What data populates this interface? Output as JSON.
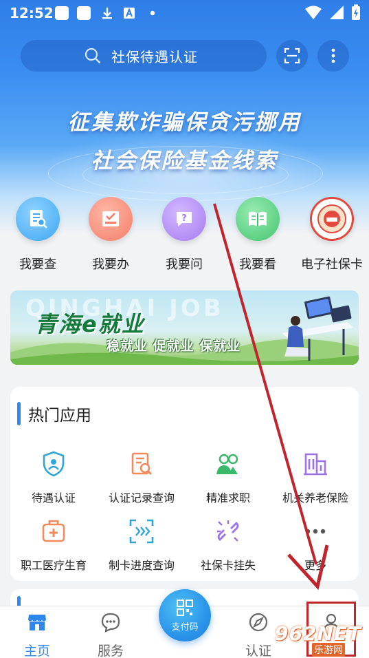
{
  "status_bar": {
    "time": "12:52"
  },
  "search": {
    "placeholder": "社保待遇认证"
  },
  "banner": {
    "line1": "征集欺诈骗保贪污挪用",
    "line2": "社会保险基金线索",
    "sub": ""
  },
  "quick_actions": [
    {
      "label": "我要查",
      "icon": "document-search-icon",
      "color": "#3fa6f2"
    },
    {
      "label": "我要办",
      "icon": "checklist-icon",
      "color": "#f57d6a"
    },
    {
      "label": "我要问",
      "icon": "chat-question-icon",
      "color": "#a57cf0"
    },
    {
      "label": "我要看",
      "icon": "open-book-icon",
      "color": "#45c46f"
    },
    {
      "label": "电子社保卡",
      "icon": "social-security-emblem-icon",
      "color": "#e5483f"
    }
  ],
  "job_banner": {
    "title": "青海e就业",
    "subtitle": "稳就业 促就业 保就业",
    "watermark": "QINGHAI JOB"
  },
  "hot_apps": {
    "title": "热门应用",
    "items": [
      {
        "label": "待遇认证",
        "icon": "shield-user-icon",
        "color": "#2fa5d8"
      },
      {
        "label": "认证记录查询",
        "icon": "record-search-icon",
        "color": "#f28a5b"
      },
      {
        "label": "精准求职",
        "icon": "people-icon",
        "color": "#3cb86a"
      },
      {
        "label": "机关养老保险",
        "icon": "building-icon",
        "color": "#9a74e8"
      },
      {
        "label": "职工医疗生育",
        "icon": "medical-kit-icon",
        "color": "#f28a5b"
      },
      {
        "label": "制卡进度查询",
        "icon": "scan-progress-icon",
        "color": "#2fa5d8"
      },
      {
        "label": "社保卡挂失",
        "icon": "broken-link-icon",
        "color": "#9a74e8"
      },
      {
        "label": "更多",
        "icon": "more-dots-icon",
        "color": "#555555"
      }
    ]
  },
  "bottom_nav": {
    "home": "主页",
    "services": "服务",
    "pay": "支付码",
    "auth": "认证",
    "mine": ""
  },
  "watermark": {
    "main": "962NET",
    "sub": "乐游网"
  },
  "colors": {
    "accent": "#2f86ee",
    "annotation": "#c0242d"
  }
}
